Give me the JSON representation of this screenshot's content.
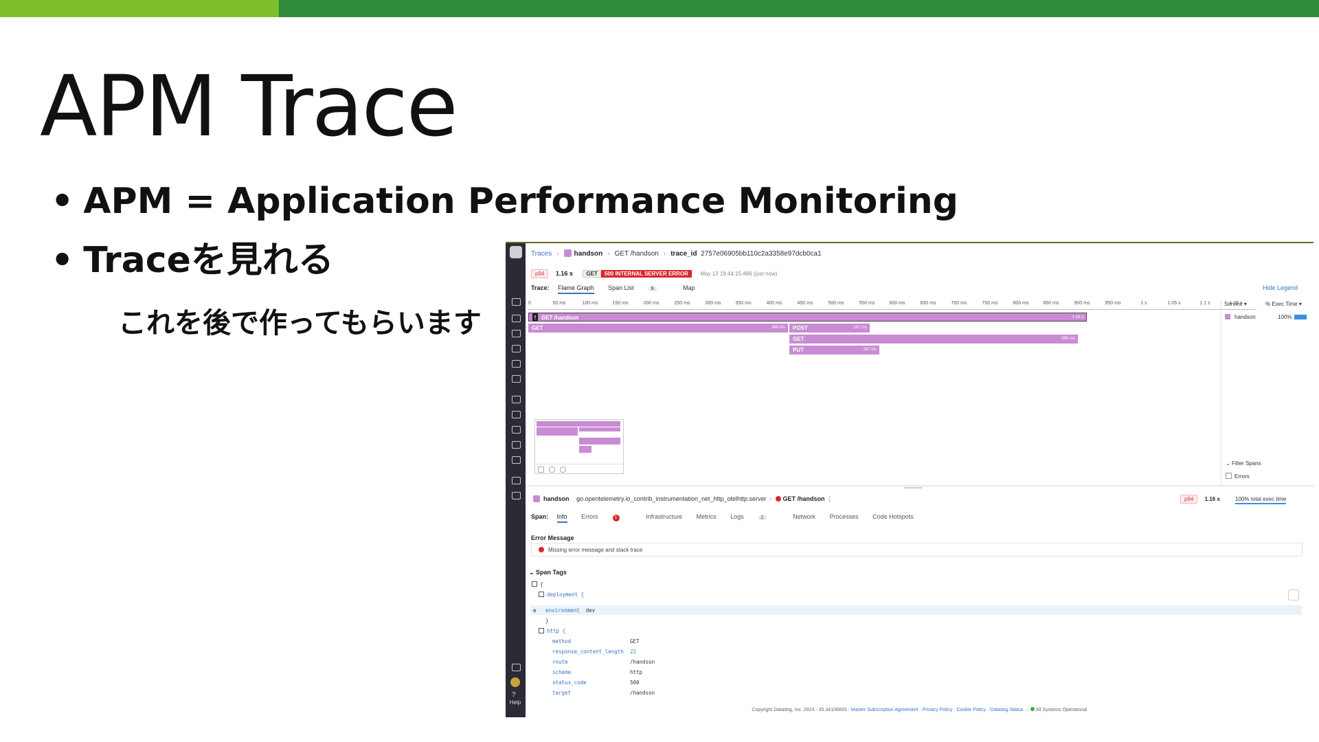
{
  "slide": {
    "title": "APM Trace",
    "bullets": [
      "APM = Application Performance Monitoring",
      "Traceを見れる"
    ],
    "sub_bullet": "これを後で作ってもらいます"
  },
  "colors": {
    "top_bar": "#2e8b3a",
    "top_bar_accent": "#7cbf2a",
    "span_color": "#c98bd3",
    "error_red": "#d9272e",
    "link_blue": "#3b71c7"
  },
  "screenshot": {
    "breadcrumb": {
      "traces": "Traces",
      "service": "handson",
      "resource": "GET /handson",
      "trace_id_label": "trace_id",
      "trace_id": "2757e06905bb110c2a3358e97dcb0ca1"
    },
    "summary": {
      "p94": "p94",
      "duration": "1.16 s",
      "method": "GET",
      "status": "500 INTERNAL SERVER ERROR",
      "timestamp": "May 13 19:44:15.486 (just now)"
    },
    "trace_tabs": {
      "label": "Trace:",
      "flame": "Flame Graph",
      "span_list": "Span List",
      "span_count": "9",
      "map": "Map"
    },
    "hide_legend": "Hide Legend",
    "axis_ticks": [
      "0",
      "50 ms",
      "100 ms",
      "150 ms",
      "200 ms",
      "250 ms",
      "300 ms",
      "350 ms",
      "400 ms",
      "450 ms",
      "500 ms",
      "550 ms",
      "600 ms",
      "650 ms",
      "700 ms",
      "750 ms",
      "800 ms",
      "850 ms",
      "900 ms",
      "950 ms",
      "1 s",
      "1.05 s",
      "1.1 s",
      "1.15 s"
    ],
    "legend": {
      "service_header": "Service",
      "exec_header": "% Exec Time",
      "service": "handson",
      "pct": "100%",
      "filter_spans": "Filter Spans",
      "errors": "Errors"
    },
    "spans": {
      "root": {
        "label": "GET /handson",
        "duration": "1.16 s"
      },
      "get1": {
        "label": "GET",
        "duration": "540 ms"
      },
      "post": {
        "label": "POST",
        "duration": "167 ms"
      },
      "get2": {
        "label": "GET",
        "duration": "599 ms"
      },
      "put": {
        "label": "PUT",
        "duration": "187 ms"
      }
    },
    "span_header": {
      "service": "handson",
      "operation": "go.opentelemetry.io_contrib_instrumentation_net_http_otelhttp.server",
      "resource": "GET /handson",
      "p94": "p94",
      "duration": "1.16 s",
      "exec": "100% total exec time"
    },
    "span_tabs": {
      "label": "Span:",
      "info": "Info",
      "errors": "Errors",
      "errors_count": "1",
      "infrastructure": "Infrastructure",
      "metrics": "Metrics",
      "logs": "Logs",
      "logs_count": "2",
      "network": "Network",
      "processes": "Processes",
      "code_hotspots": "Code Hotspots"
    },
    "error": {
      "title": "Error Message",
      "message": "Missing error message and stack trace"
    },
    "tags": {
      "title": "Span Tags",
      "open_brace": "{",
      "deployment": "deployment {",
      "env_key": "environment",
      "env_val": "dev",
      "close": "}",
      "http": "http {",
      "rows": [
        {
          "key": "method",
          "val": "GET"
        },
        {
          "key": "response_content_length",
          "val": "22"
        },
        {
          "key": "route",
          "val": "/handson"
        },
        {
          "key": "scheme",
          "val": "http"
        },
        {
          "key": "status_code",
          "val": "500"
        },
        {
          "key": "target",
          "val": "/handson"
        }
      ]
    },
    "nav": {
      "help": "Help",
      "help_q": "?"
    },
    "footer": {
      "copyright": "Copyright Datadog, Inc. 2024 - 35.34106893 · ",
      "msa": "Master Subscription Agreement",
      "privacy": "Privacy Policy",
      "cookie": "Cookie Policy",
      "status": "Datadog Status →",
      "ops": "All Systems Operational"
    }
  }
}
